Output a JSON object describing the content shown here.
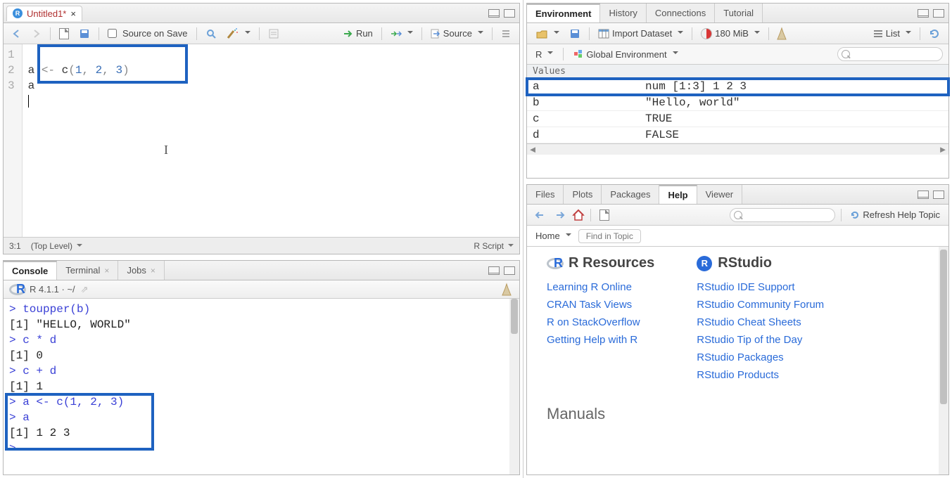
{
  "source": {
    "tab_title": "Untitled1*",
    "toolbar": {
      "source_on_save": "Source on Save",
      "run": "Run",
      "source_btn": "Source"
    },
    "lines": [
      "1",
      "2",
      "3"
    ],
    "code_tokens": {
      "l1_a": "a ",
      "l1_arrow": "<- ",
      "l1_c": "c",
      "l1_p1": "(",
      "l1_n1": "1",
      "l1_c1": ", ",
      "l1_n2": "2",
      "l1_c2": ", ",
      "l1_n3": "3",
      "l1_p2": ")",
      "l2": "a"
    },
    "status_pos": "3:1",
    "status_scope": "(Top Level)",
    "status_type": "R Script"
  },
  "console": {
    "tabs": {
      "console": "Console",
      "terminal": "Terminal",
      "jobs": "Jobs"
    },
    "header": "R 4.1.1 · ~/",
    "lines": [
      {
        "t": "> toupper(b)",
        "cls": "prompt"
      },
      {
        "t": "[1] \"HELLO, WORLD\"",
        "cls": "out"
      },
      {
        "t": "> c * d",
        "cls": "prompt"
      },
      {
        "t": "[1] 0",
        "cls": "out"
      },
      {
        "t": "> c + d",
        "cls": "prompt"
      },
      {
        "t": "[1] 1",
        "cls": "out"
      },
      {
        "t": "> a <- c(1, 2, 3)",
        "cls": "prompt"
      },
      {
        "t": "> a",
        "cls": "prompt"
      },
      {
        "t": "[1] 1 2 3",
        "cls": "out"
      },
      {
        "t": "> ",
        "cls": "prompt"
      }
    ]
  },
  "env": {
    "tabs": {
      "env": "Environment",
      "hist": "History",
      "conn": "Connections",
      "tut": "Tutorial"
    },
    "import": "Import Dataset",
    "mem": "180 MiB",
    "view": "List",
    "scope_r": "R",
    "scope_env": "Global Environment",
    "section": "Values",
    "rows": [
      {
        "name": "a",
        "val": "num [1:3] 1 2 3",
        "hl": true
      },
      {
        "name": "b",
        "val": "\"Hello, world\""
      },
      {
        "name": "c",
        "val": "TRUE"
      },
      {
        "name": "d",
        "val": "FALSE"
      }
    ]
  },
  "help": {
    "tabs": {
      "files": "Files",
      "plots": "Plots",
      "pkgs": "Packages",
      "help": "Help",
      "viewer": "Viewer"
    },
    "refresh": "Refresh Help Topic",
    "home": "Home",
    "find": "Find in Topic",
    "h1": "R Resources",
    "h2": "RStudio",
    "links1": [
      "Learning R Online",
      "CRAN Task Views",
      "R on StackOverflow",
      "Getting Help with R"
    ],
    "links2": [
      "RStudio IDE Support",
      "RStudio Community Forum",
      "RStudio Cheat Sheets",
      "RStudio Tip of the Day",
      "RStudio Packages",
      "RStudio Products"
    ],
    "manuals": "Manuals"
  }
}
